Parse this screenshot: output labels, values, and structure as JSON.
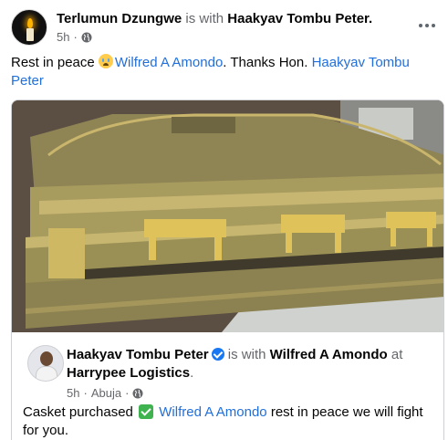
{
  "post": {
    "author": "Terlumun Dzungwe",
    "with_text": "is with",
    "tagged": "Haakyav Tombu Peter.",
    "time": "5h",
    "dot": "·",
    "text_prefix": "Rest in peace ",
    "mention_1": "Wilfred A Amondo",
    "text_middle": ". Thanks Hon. ",
    "mention_2": "Haakyav Tombu Peter",
    "emoji": "crying-face-emoji"
  },
  "shared": {
    "author": "Haakyav Tombu Peter",
    "with_text": "is with",
    "tagged": "Wilfred A Amondo",
    "at_text": "at",
    "place": "Harrypee Logistics",
    "place_end": ".",
    "time": "5h",
    "dot": "·",
    "location": "Abuja",
    "dot2": "·",
    "text_prefix": "Casket purchased ",
    "mention": "Wilfred A Amondo",
    "text_suffix": " rest in peace we will fight for you."
  },
  "colors": {
    "link": "#216fdb",
    "muted": "#65676b",
    "verified": "#1877f2"
  },
  "icons": {
    "avatar": "candle-avatar",
    "privacy": "globe-icon",
    "more": "more-icon",
    "verified": "verified-badge-icon",
    "check": "check-mark-emoji"
  }
}
